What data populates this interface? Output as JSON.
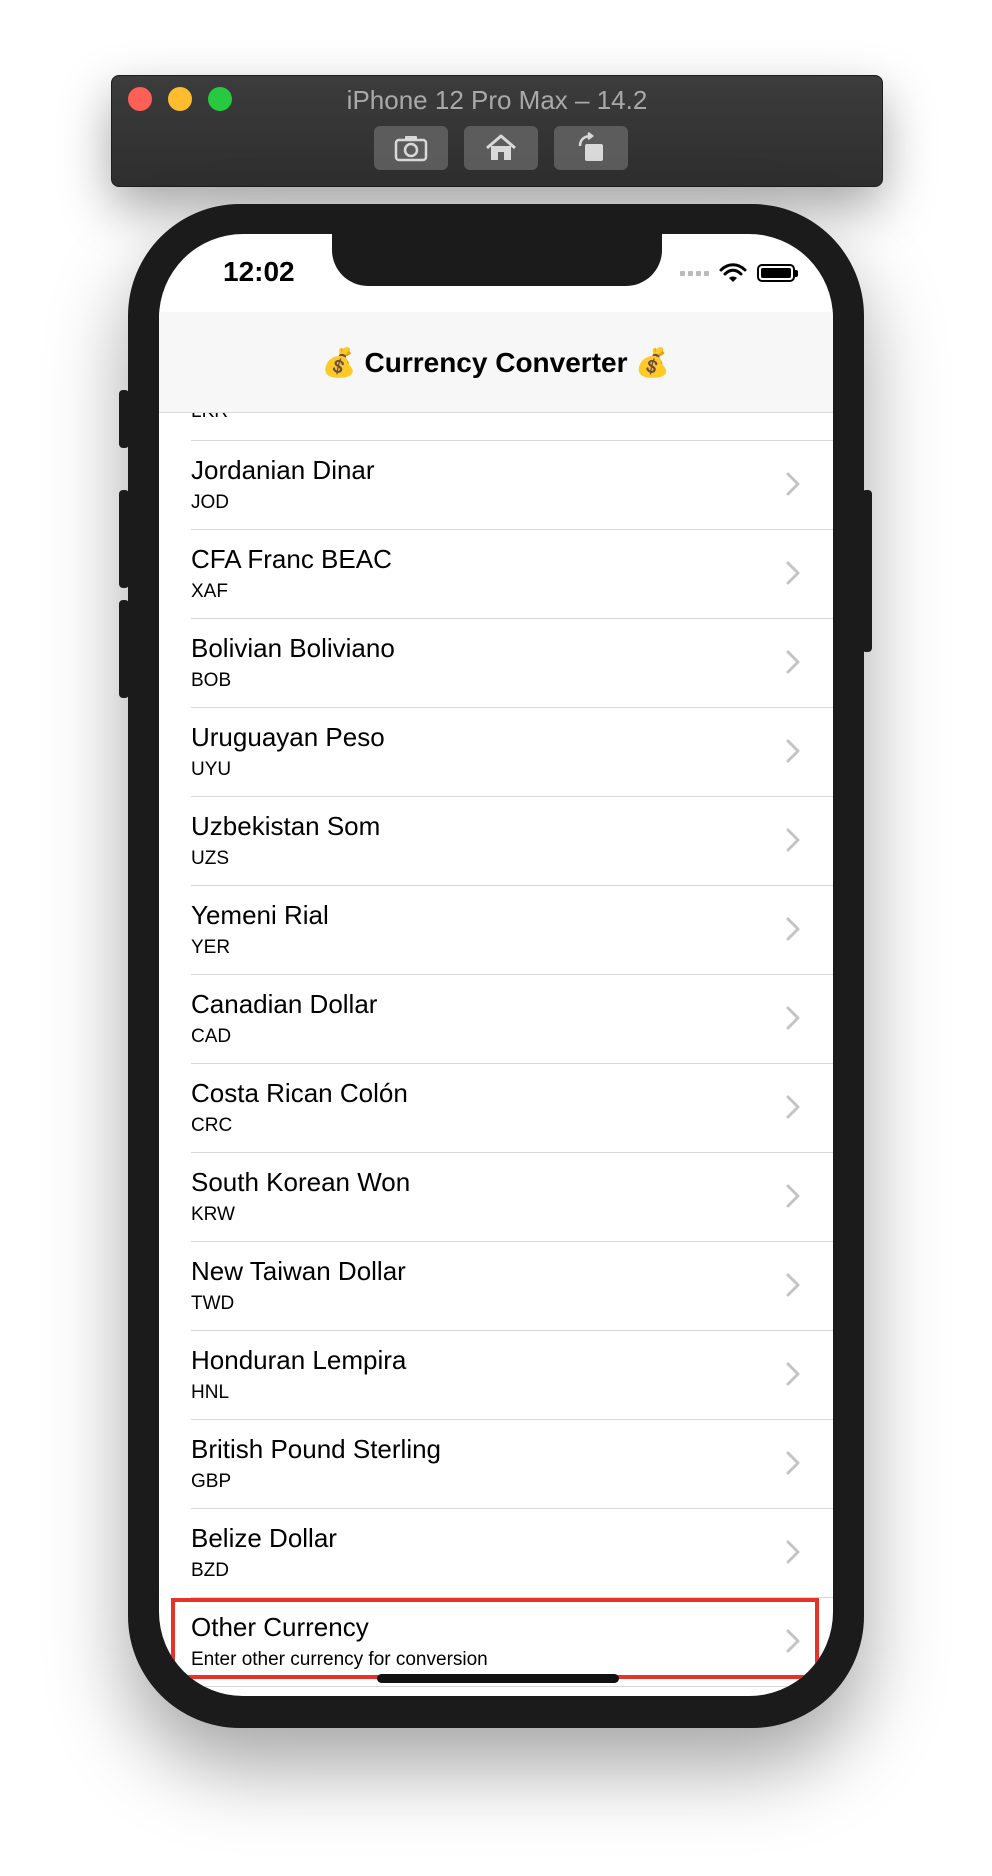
{
  "simulator": {
    "title": "iPhone 12 Pro Max – 14.2",
    "buttons": [
      {
        "icon": "camera-icon"
      },
      {
        "icon": "home-icon"
      },
      {
        "icon": "rotate-icon"
      }
    ]
  },
  "status_bar": {
    "time": "12:02"
  },
  "nav": {
    "title": "💰 Currency Converter 💰"
  },
  "list": {
    "partial_code": "LKR",
    "items": [
      {
        "name": "Jordanian Dinar",
        "code": "JOD"
      },
      {
        "name": "CFA Franc BEAC",
        "code": "XAF"
      },
      {
        "name": "Bolivian Boliviano",
        "code": "BOB"
      },
      {
        "name": "Uruguayan Peso",
        "code": "UYU"
      },
      {
        "name": "Uzbekistan Som",
        "code": "UZS"
      },
      {
        "name": "Yemeni Rial",
        "code": "YER"
      },
      {
        "name": "Canadian Dollar",
        "code": "CAD"
      },
      {
        "name": "Costa Rican Colón",
        "code": "CRC"
      },
      {
        "name": "South Korean Won",
        "code": "KRW"
      },
      {
        "name": "New Taiwan Dollar",
        "code": "TWD"
      },
      {
        "name": "Honduran Lempira",
        "code": "HNL"
      },
      {
        "name": "British Pound Sterling",
        "code": "GBP"
      },
      {
        "name": "Belize Dollar",
        "code": "BZD"
      },
      {
        "name": "Other Currency",
        "code": "Enter other currency for conversion"
      }
    ]
  },
  "colors": {
    "highlight": "#e5332a",
    "chevron": "#c4c4c7",
    "navbar_bg": "#f7f7f7"
  }
}
